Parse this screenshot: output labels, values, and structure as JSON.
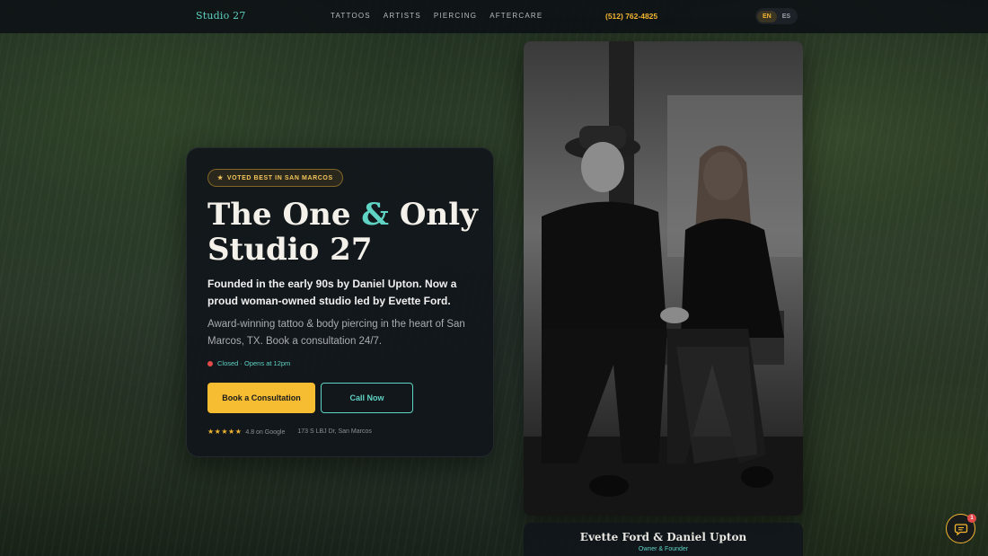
{
  "nav": {
    "brand": "Studio 27",
    "links": [
      "TATTOOS",
      "ARTISTS",
      "PIERCING",
      "AFTERCARE"
    ],
    "phone": "(512) 762-4825",
    "languages": [
      {
        "code": "EN",
        "active": true
      },
      {
        "code": "ES",
        "active": false
      }
    ]
  },
  "hero": {
    "badge": "VOTED BEST IN SAN MARCOS",
    "badge_icon": "star-icon",
    "title_part1": "The One ",
    "title_amp": "&",
    "title_part2": " Only",
    "title_line2": "Studio 27",
    "lead": "Founded in the early 90s by Daniel Upton. Now a proud woman-owned studio led by Evette Ford.",
    "description": "Award-winning tattoo & body piercing in the heart of San Marcos, TX. Book a consultation 24/7.",
    "status": "Closed · Opens at 12pm",
    "status_color": "#e34b4b",
    "primary_button": "Book a Consultation",
    "secondary_button": "Call Now",
    "stars": "★★★★★",
    "rating": "4.8 on Google",
    "address": "173 S LBJ Dr, San Marcos"
  },
  "photo_caption": {
    "name": "Evette Ford & Daniel Upton",
    "role": "Owner & Founder"
  },
  "chat": {
    "icon": "chat-bubble-icon",
    "badge_count": "1"
  },
  "colors": {
    "accent_teal": "#5fd3c4",
    "accent_gold": "#f2b531",
    "card_bg": "#11161b"
  }
}
